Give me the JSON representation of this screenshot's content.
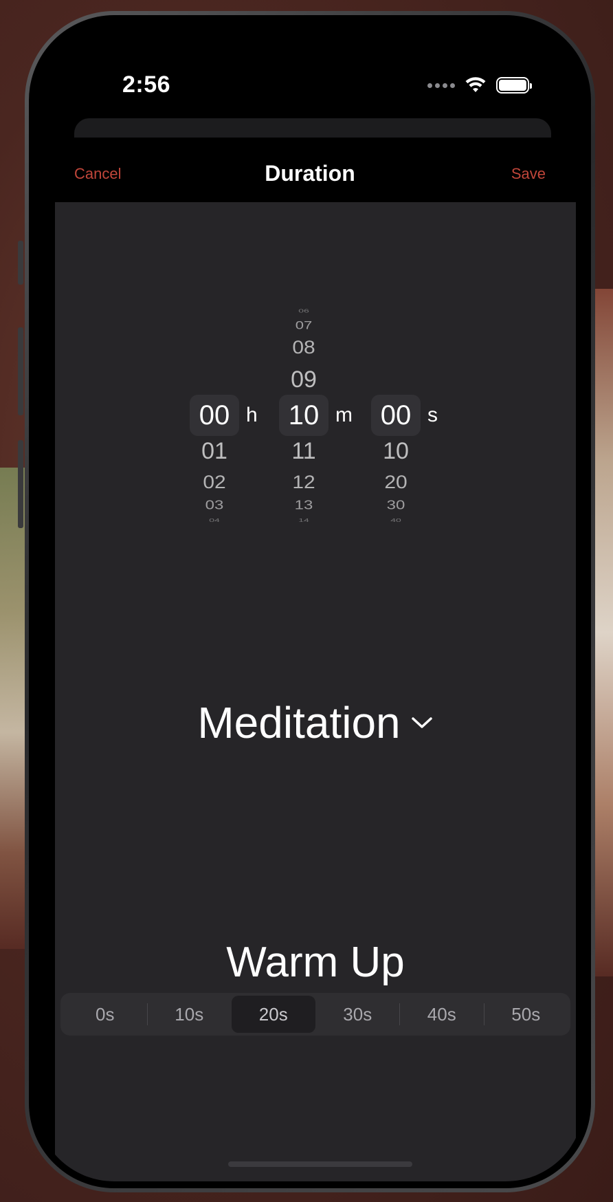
{
  "status_bar": {
    "time": "2:56"
  },
  "nav": {
    "cancel": "Cancel",
    "title": "Duration",
    "save": "Save"
  },
  "picker": {
    "hours": {
      "above": [],
      "selected": "00",
      "below": [
        "01",
        "02",
        "03",
        "04"
      ],
      "unit": "h"
    },
    "minutes": {
      "above": [
        "06",
        "07",
        "08",
        "09"
      ],
      "selected": "10",
      "below": [
        "11",
        "12",
        "13",
        "14"
      ],
      "unit": "m"
    },
    "seconds": {
      "above": [],
      "selected": "00",
      "below": [
        "10",
        "20",
        "30",
        "40"
      ],
      "unit": "s"
    }
  },
  "meditation": {
    "label": "Meditation",
    "icon": "chevron-down-icon"
  },
  "warmup": {
    "title": "Warm Up",
    "options": [
      "0s",
      "10s",
      "20s",
      "30s",
      "40s",
      "50s"
    ],
    "selected_index": 2
  },
  "colors": {
    "accent": "#c1463a",
    "background": "#262528",
    "selected_segment": "#1f1e21"
  }
}
